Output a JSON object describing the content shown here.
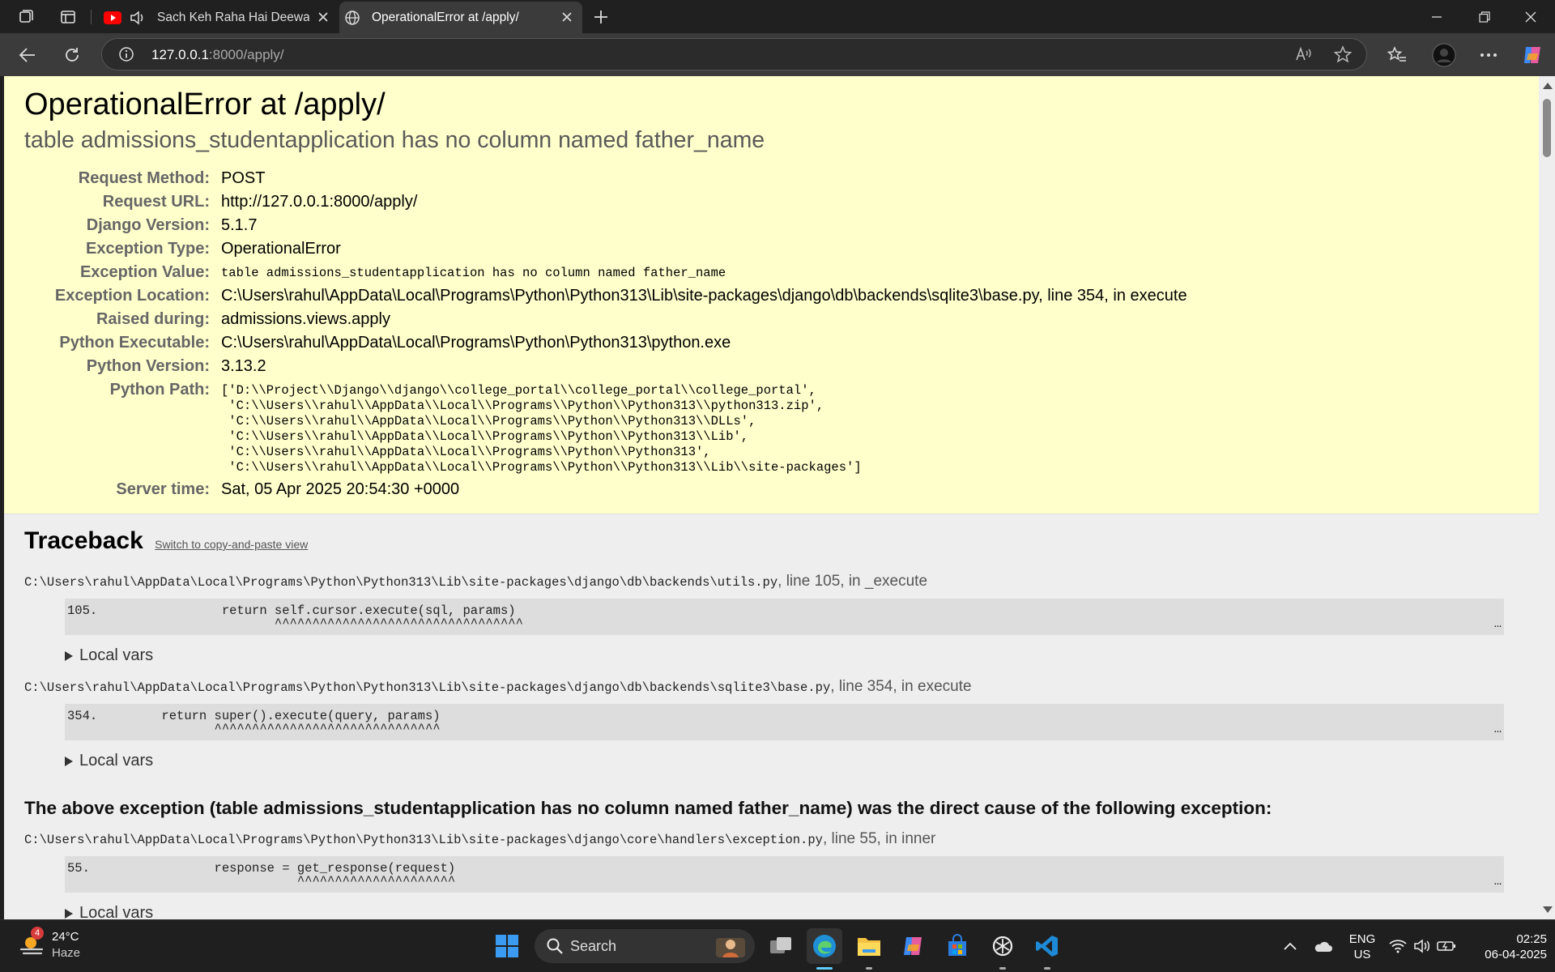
{
  "browser": {
    "tabs": [
      {
        "title": "Sach Keh Raha Hai Deewana",
        "active": false
      },
      {
        "title": "OperationalError at /apply/",
        "active": true
      }
    ],
    "address": {
      "host": "127.0.0.1",
      "path": ":8000/apply/"
    }
  },
  "error": {
    "title": "OperationalError at /apply/",
    "message": "table admissions_studentapplication has no column named father_name",
    "meta": [
      {
        "label": "Request Method:",
        "value": "POST"
      },
      {
        "label": "Request URL:",
        "value": "http://127.0.0.1:8000/apply/"
      },
      {
        "label": "Django Version:",
        "value": "5.1.7"
      },
      {
        "label": "Exception Type:",
        "value": "OperationalError"
      },
      {
        "label": "Exception Value:",
        "value": "table admissions_studentapplication has no column named father_name"
      },
      {
        "label": "Exception Location:",
        "value": "C:\\Users\\rahul\\AppData\\Local\\Programs\\Python\\Python313\\Lib\\site-packages\\django\\db\\backends\\sqlite3\\base.py, line 354, in execute"
      },
      {
        "label": "Raised during:",
        "value": "admissions.views.apply"
      },
      {
        "label": "Python Executable:",
        "value": "C:\\Users\\rahul\\AppData\\Local\\Programs\\Python\\Python313\\python.exe"
      },
      {
        "label": "Python Version:",
        "value": "3.13.2"
      },
      {
        "label": "Python Path:",
        "value": "['D:\\\\Project\\\\Django\\\\django\\\\college_portal\\\\college_portal\\\\college_portal',\n 'C:\\\\Users\\\\rahul\\\\AppData\\\\Local\\\\Programs\\\\Python\\\\Python313\\\\python313.zip',\n 'C:\\\\Users\\\\rahul\\\\AppData\\\\Local\\\\Programs\\\\Python\\\\Python313\\\\DLLs',\n 'C:\\\\Users\\\\rahul\\\\AppData\\\\Local\\\\Programs\\\\Python\\\\Python313\\\\Lib',\n 'C:\\\\Users\\\\rahul\\\\AppData\\\\Local\\\\Programs\\\\Python\\\\Python313',\n 'C:\\\\Users\\\\rahul\\\\AppData\\\\Local\\\\Programs\\\\Python\\\\Python313\\\\Lib\\\\site-packages']"
      },
      {
        "label": "Server time:",
        "value": "Sat, 05 Apr 2025 20:54:30 +0000"
      }
    ]
  },
  "traceback": {
    "heading": "Traceback",
    "switch_link": "Switch to copy-and-paste view",
    "frames": [
      {
        "file": "C:\\Users\\rahul\\AppData\\Local\\Programs\\Python\\Python313\\Lib\\site-packages\\django\\db\\backends\\utils.py",
        "where": ", line 105, in _execute",
        "lineno": "105.",
        "code": "                return self.cursor.execute(sql, params)",
        "carets": "                       ^^^^^^^^^^^^^^^^^^^^^^^^^^^^^^^^^",
        "more": "…",
        "local_vars": "Local vars"
      },
      {
        "file": "C:\\Users\\rahul\\AppData\\Local\\Programs\\Python\\Python313\\Lib\\site-packages\\django\\db\\backends\\sqlite3\\base.py",
        "where": ", line 354, in execute",
        "lineno": "354.",
        "code": "        return super().execute(query, params)",
        "carets": "               ^^^^^^^^^^^^^^^^^^^^^^^^^^^^^^",
        "more": "…",
        "local_vars": "Local vars"
      }
    ],
    "cause": "The above exception (table admissions_studentapplication has no column named father_name) was the direct cause of the following exception:",
    "frame3": {
      "file": "C:\\Users\\rahul\\AppData\\Local\\Programs\\Python\\Python313\\Lib\\site-packages\\django\\core\\handlers\\exception.py",
      "where": ", line 55, in inner",
      "lineno": "55.",
      "code": "               response = get_response(request)",
      "carets": "                          ^^^^^^^^^^^^^^^^^^^^^",
      "more": "…",
      "local_vars": "Local vars"
    }
  },
  "taskbar": {
    "weather": {
      "temp": "24°C",
      "condition": "Haze",
      "badge": "4"
    },
    "search_label": "Search",
    "language": {
      "line1": "ENG",
      "line2": "US"
    },
    "clock": {
      "time": "02:25",
      "date": "06-04-2025"
    }
  },
  "colors": {
    "summary_bg": "#ffffcc",
    "page_bg": "#eeeeee",
    "code_bg": "#dddddd"
  }
}
